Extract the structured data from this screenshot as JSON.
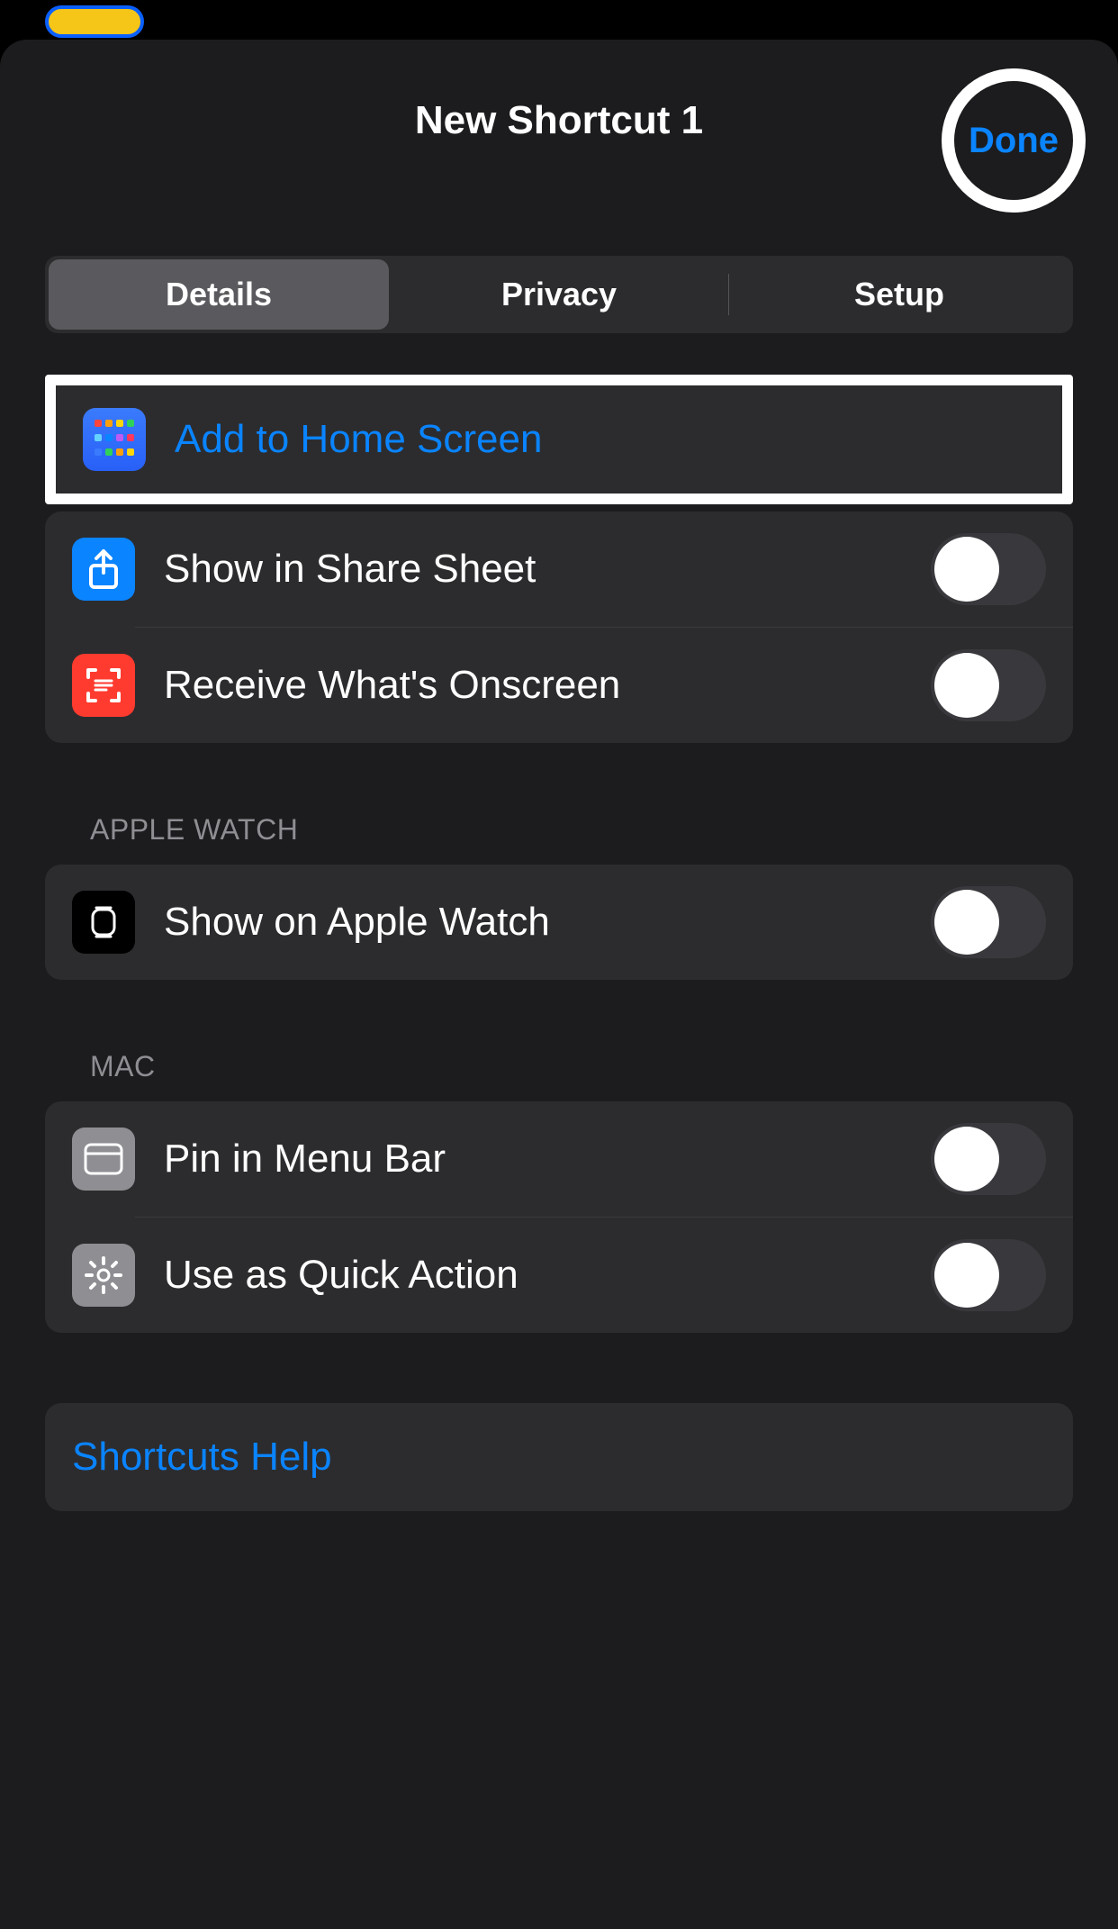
{
  "header": {
    "title": "New Shortcut 1",
    "done_label": "Done"
  },
  "tabs": {
    "details": "Details",
    "privacy": "Privacy",
    "setup": "Setup"
  },
  "rows": {
    "add_home": "Add to Home Screen",
    "share_sheet": "Show in Share Sheet",
    "onscreen": "Receive What's Onscreen"
  },
  "apple_watch_section": {
    "header": "APPLE WATCH",
    "show_on_watch": "Show on Apple Watch"
  },
  "mac_section": {
    "header": "MAC",
    "pin_menu": "Pin in Menu Bar",
    "quick_action": "Use as Quick Action"
  },
  "help": {
    "label": "Shortcuts Help"
  }
}
